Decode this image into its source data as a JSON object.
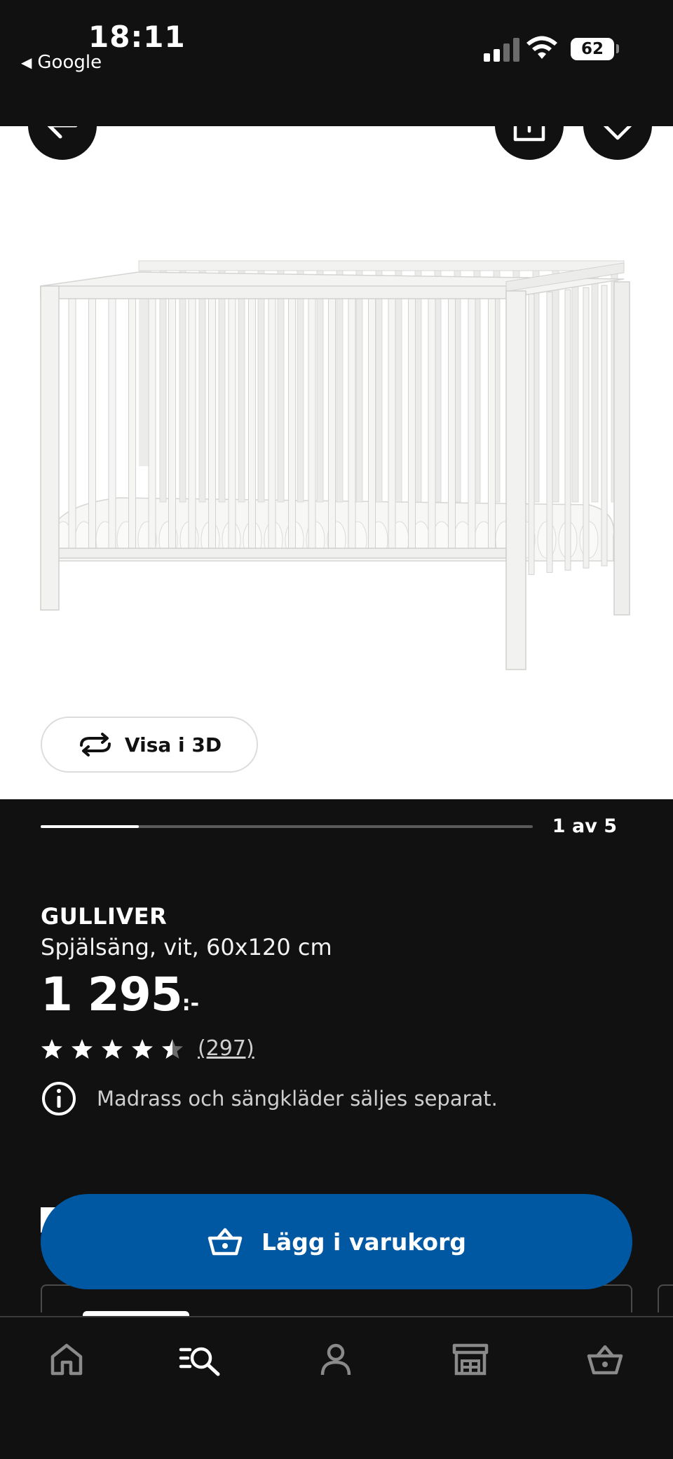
{
  "status_bar": {
    "time": "18:11",
    "back_app": "Google",
    "battery": "62"
  },
  "gallery": {
    "view_3d_label": "Visa i 3D",
    "position_label": "1 av 5",
    "current_index": 1,
    "total": 5
  },
  "product": {
    "name": "GULLIVER",
    "description": "Spjälsäng, vit, 60x120 cm",
    "price": "1 295",
    "price_suffix": ":-",
    "rating": 4.5,
    "rating_max": 5,
    "review_count": "(297)",
    "notice": "Madrass och sängkläder säljes separat."
  },
  "cart_button": {
    "label": "Lägg i varukorg"
  },
  "nav": {
    "items": [
      "home-icon",
      "search-list-icon",
      "profile-icon",
      "store-icon",
      "basket-icon"
    ],
    "active_index": 1
  },
  "colors": {
    "background": "#111111",
    "accent_blue": "#0058a3",
    "hero_bg": "#ffffff"
  }
}
